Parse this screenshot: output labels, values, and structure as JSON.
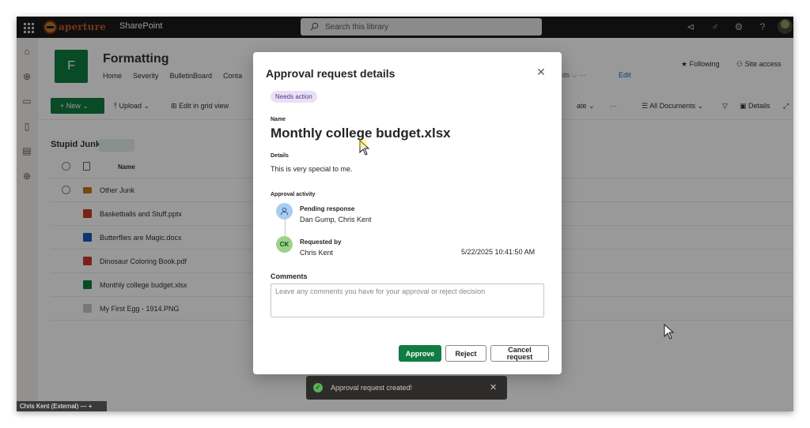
{
  "topbar": {
    "brand": "aperture",
    "app_name": "SharePoint",
    "search_placeholder": "Search this library"
  },
  "site": {
    "tile_letter": "F",
    "title": "Formatting",
    "nav": [
      "Home",
      "Severity",
      "BulletinBoard",
      "Conta"
    ],
    "nav_extra": "nts ⌵   ···",
    "edit": "Edit",
    "following": "Following",
    "site_access": "Site access"
  },
  "commands": {
    "new": "New",
    "upload": "Upload",
    "edit_grid": "Edit in grid view",
    "automate": "ate",
    "more": "···",
    "all_documents": "All Documents",
    "details": "Details"
  },
  "library": {
    "title": "Stupid Junk",
    "column_name": "Name",
    "rows": [
      {
        "name": "Other Junk",
        "type": "folder"
      },
      {
        "name": "Basketballs and Stuff.pptx",
        "type": "pptx"
      },
      {
        "name": "Butterflies are Magic.docx",
        "type": "docx"
      },
      {
        "name": "Dinosaur Coloring Book.pdf",
        "type": "pdf"
      },
      {
        "name": "Monthly college budget.xlsx",
        "type": "xlsx"
      },
      {
        "name": "My First Egg - 1914.PNG",
        "type": "png"
      }
    ]
  },
  "modal": {
    "title": "Approval request details",
    "badge": "Needs action",
    "name_label": "Name",
    "name_value": "Monthly college budget.xlsx",
    "details_label": "Details",
    "details_value": "This is very special to me.",
    "activity_label": "Approval activity",
    "pending_title": "Pending response",
    "pending_people": "Dan Gump, Chris Kent",
    "requested_title": "Requested by",
    "requested_initials": "CK",
    "requested_person": "Chris Kent",
    "requested_date": "5/22/2025 10:41:50 AM",
    "comments_label": "Comments",
    "comments_placeholder": "Leave any comments you have for your approval or reject decision",
    "approve": "Approve",
    "reject": "Reject",
    "cancel_line1": "Cancel",
    "cancel_line2": "request"
  },
  "toast": {
    "message": "Approval request created!"
  },
  "statusbar": {
    "label": "Chris Kent (External) — +"
  },
  "colors": {
    "brand_green": "#107c41",
    "badge_bg": "#e8e1f5",
    "badge_text": "#5c2e91",
    "toast_bg": "#2d2c2b"
  }
}
